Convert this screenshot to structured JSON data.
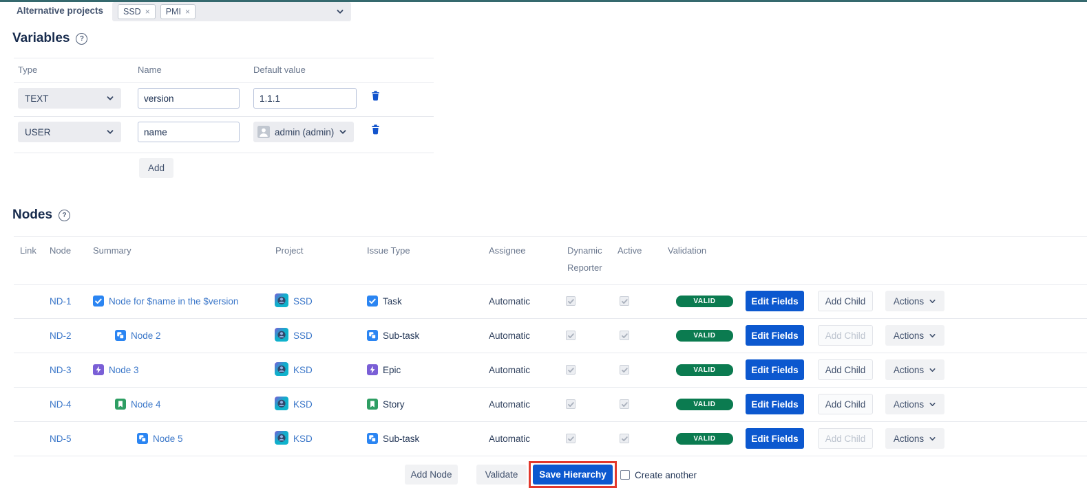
{
  "alt_projects": {
    "label": "Alternative projects",
    "remove_glyph": "×",
    "tags": [
      {
        "text": "SSD"
      },
      {
        "text": "PMI"
      }
    ]
  },
  "variables": {
    "title": "Variables",
    "help": "?",
    "columns": {
      "type": "Type",
      "name": "Name",
      "default": "Default value"
    },
    "rows": [
      {
        "type": "TEXT",
        "name": "version",
        "default": "1.1.1"
      },
      {
        "type": "USER",
        "name": "name",
        "default": "admin (admin)"
      }
    ],
    "add_label": "Add"
  },
  "nodes": {
    "title": "Nodes",
    "help": "?",
    "columns": {
      "link": "Link",
      "node": "Node",
      "summary": "Summary",
      "project": "Project",
      "issue_type": "Issue Type",
      "assignee": "Assignee",
      "dynamic": "Dynamic",
      "reporter": "Reporter",
      "active": "Active",
      "validation": "Validation"
    },
    "rows": [
      {
        "node": "ND-1",
        "summary": "Node for $name in the $version",
        "indent": 0,
        "project": "SSD",
        "issue_type": "Task",
        "assignee": "Automatic",
        "dynamic_checked": true,
        "active_checked": true,
        "validation": "VALID",
        "edit_fields": "Edit Fields",
        "add_child": "Add Child",
        "add_child_enabled": true,
        "actions": "Actions"
      },
      {
        "node": "ND-2",
        "summary": "Node 2",
        "indent": 1,
        "project": "SSD",
        "issue_type": "Sub-task",
        "assignee": "Automatic",
        "dynamic_checked": true,
        "active_checked": true,
        "validation": "VALID",
        "edit_fields": "Edit Fields",
        "add_child": "Add Child",
        "add_child_enabled": false,
        "actions": "Actions"
      },
      {
        "node": "ND-3",
        "summary": "Node 3",
        "indent": 0,
        "project": "KSD",
        "issue_type": "Epic",
        "assignee": "Automatic",
        "dynamic_checked": true,
        "active_checked": true,
        "validation": "VALID",
        "edit_fields": "Edit Fields",
        "add_child": "Add Child",
        "add_child_enabled": true,
        "actions": "Actions"
      },
      {
        "node": "ND-4",
        "summary": "Node 4",
        "indent": 1,
        "project": "KSD",
        "issue_type": "Story",
        "assignee": "Automatic",
        "dynamic_checked": true,
        "active_checked": true,
        "validation": "VALID",
        "edit_fields": "Edit Fields",
        "add_child": "Add Child",
        "add_child_enabled": true,
        "actions": "Actions"
      },
      {
        "node": "ND-5",
        "summary": "Node 5",
        "indent": 2,
        "project": "KSD",
        "issue_type": "Sub-task",
        "assignee": "Automatic",
        "dynamic_checked": true,
        "active_checked": true,
        "validation": "VALID",
        "edit_fields": "Edit Fields",
        "add_child": "Add Child",
        "add_child_enabled": false,
        "actions": "Actions"
      }
    ],
    "footer": {
      "add_node": "Add Node",
      "validate": "Validate",
      "save": "Save Hierarchy",
      "create_another": "Create another"
    }
  },
  "colors": {
    "topbar_teal": "#35696E",
    "primary_blue": "#0C58CF",
    "link_blue": "#3B77C9",
    "valid_green": "#0B7B50",
    "task_blue": "#2B85F2",
    "epic_purple": "#7A5FD6",
    "story_green": "#2E9E63",
    "project_teal": "#10AECB",
    "annotation_red": "#E2382C",
    "trash_blue": "#1254CC"
  }
}
